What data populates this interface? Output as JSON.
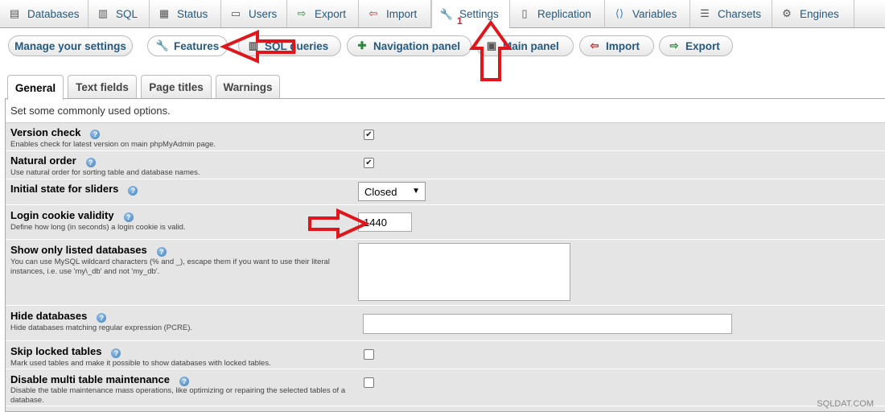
{
  "topmenu": [
    {
      "label": "Databases",
      "icon": "databases-icon"
    },
    {
      "label": "SQL",
      "icon": "sql-icon"
    },
    {
      "label": "Status",
      "icon": "status-icon"
    },
    {
      "label": "Users",
      "icon": "users-icon"
    },
    {
      "label": "Export",
      "icon": "export-icon"
    },
    {
      "label": "Import",
      "icon": "import-icon"
    },
    {
      "label": "Settings",
      "icon": "wrench-icon",
      "active": true
    },
    {
      "label": "Replication",
      "icon": "replication-icon"
    },
    {
      "label": "Variables",
      "icon": "variables-icon"
    },
    {
      "label": "Charsets",
      "icon": "charsets-icon"
    },
    {
      "label": "Engines",
      "icon": "engines-icon"
    }
  ],
  "annotation_number": "1",
  "submenu": {
    "manage": "Manage your settings",
    "items": [
      {
        "label": "Features",
        "icon": "wrench-icon"
      },
      {
        "label": "SQL queries",
        "icon": "sql-icon"
      },
      {
        "label": "Navigation panel",
        "icon": "navigation-icon"
      },
      {
        "label": "Main panel",
        "icon": "main-panel-icon"
      },
      {
        "label": "Import",
        "icon": "import-icon"
      },
      {
        "label": "Export",
        "icon": "export-icon"
      }
    ]
  },
  "subtabs": [
    "General",
    "Text fields",
    "Page titles",
    "Warnings"
  ],
  "intro": "Set some commonly used options.",
  "rows": {
    "version_check": {
      "label": "Version check",
      "desc": "Enables check for latest version on main phpMyAdmin page.",
      "checked": true
    },
    "natural_order": {
      "label": "Natural order",
      "desc": "Use natural order for sorting table and database names.",
      "checked": true
    },
    "sliders": {
      "label": "Initial state for sliders",
      "value": "Closed"
    },
    "login_cookie": {
      "label": "Login cookie validity",
      "desc": "Define how long (in seconds) a login cookie is valid.",
      "value": "1440"
    },
    "listed_dbs": {
      "label": "Show only listed databases",
      "desc": "You can use MySQL wildcard characters (% and _), escape them if you want to use their literal instances, i.e. use 'my\\_db' and not 'my_db'.",
      "value": ""
    },
    "hide_dbs": {
      "label": "Hide databases",
      "desc": "Hide databases matching regular expression (PCRE).",
      "value": ""
    },
    "skip_locked": {
      "label": "Skip locked tables",
      "desc": "Mark used tables and make it possible to show databases with locked tables.",
      "checked": false
    },
    "multi_maint": {
      "label": "Disable multi table maintenance",
      "desc": "Disable the table maintenance mass operations, like optimizing or repairing the selected tables of a database.",
      "checked": false
    }
  },
  "watermark": "SQLDAT.COM",
  "colors": {
    "link": "#235a81",
    "arrow": "#e0161d",
    "row_bg": "#e5e5e5"
  }
}
